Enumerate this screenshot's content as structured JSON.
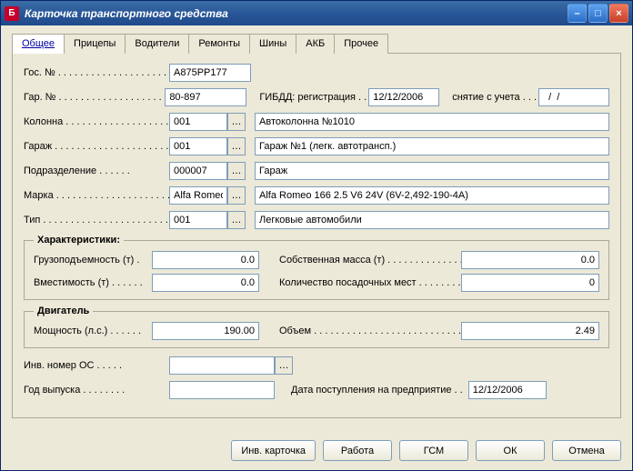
{
  "window": {
    "title": "Карточка транспортного средства"
  },
  "tabs": [
    "Общее",
    "Прицепы",
    "Водители",
    "Ремонты",
    "Шины",
    "АКБ",
    "Прочее"
  ],
  "labels": {
    "gos_no": "Гос. №",
    "gar_no": "Гар. №",
    "gibdd_reg": "ГИБДД: регистрация . .",
    "gibdd_dereg": "снятие с учета . . .",
    "kolonna": "Колонна",
    "garage": "Гараж",
    "podrazdelenie": "Подразделение",
    "marka": "Марка",
    "tip": "Тип",
    "gruz": "Грузоподъемность (т) .",
    "sobmass": "Собственная масса (т)",
    "vmest": "Вместимость (т)",
    "posad": "Количество посадочных мест",
    "power": "Мощность (л.с.)",
    "objem": "Объем",
    "inos": "Инв. номер ОС",
    "year": "Год выпуска",
    "date_in": "Дата поступления на предприятие . .",
    "legend_char": "Характеристики:",
    "legend_eng": "Двигатель"
  },
  "fields": {
    "gos_no": "А875РР177",
    "gar_no": "80-897",
    "gibdd_reg": "12/12/2006",
    "gibdd_dereg": "  /  /",
    "kolonna_code": "001",
    "kolonna_name": "Автоколонна №1010",
    "garage_code": "001",
    "garage_name": "Гараж №1 (легк. автотрансп.)",
    "podr_code": "000007",
    "podr_name": "Гараж",
    "marka_code": "Alfa Romeo",
    "marka_name": "Alfa Romeo 166 2.5 V6 24V (6V-2,492-190-4A)",
    "tip_code": "001",
    "tip_name": "Легковые автомобили",
    "gruz": "0.0",
    "sobmass": "0.0",
    "vmest": "0.0",
    "posad": "0",
    "power": "190.00",
    "objem": "2.49",
    "inos": "",
    "year": "",
    "date_in": "12/12/2006"
  },
  "buttons": {
    "inv": "Инв. карточка",
    "work": "Работа",
    "gsm": "ГСМ",
    "ok": "ОК",
    "cancel": "Отмена"
  },
  "ell": "…"
}
